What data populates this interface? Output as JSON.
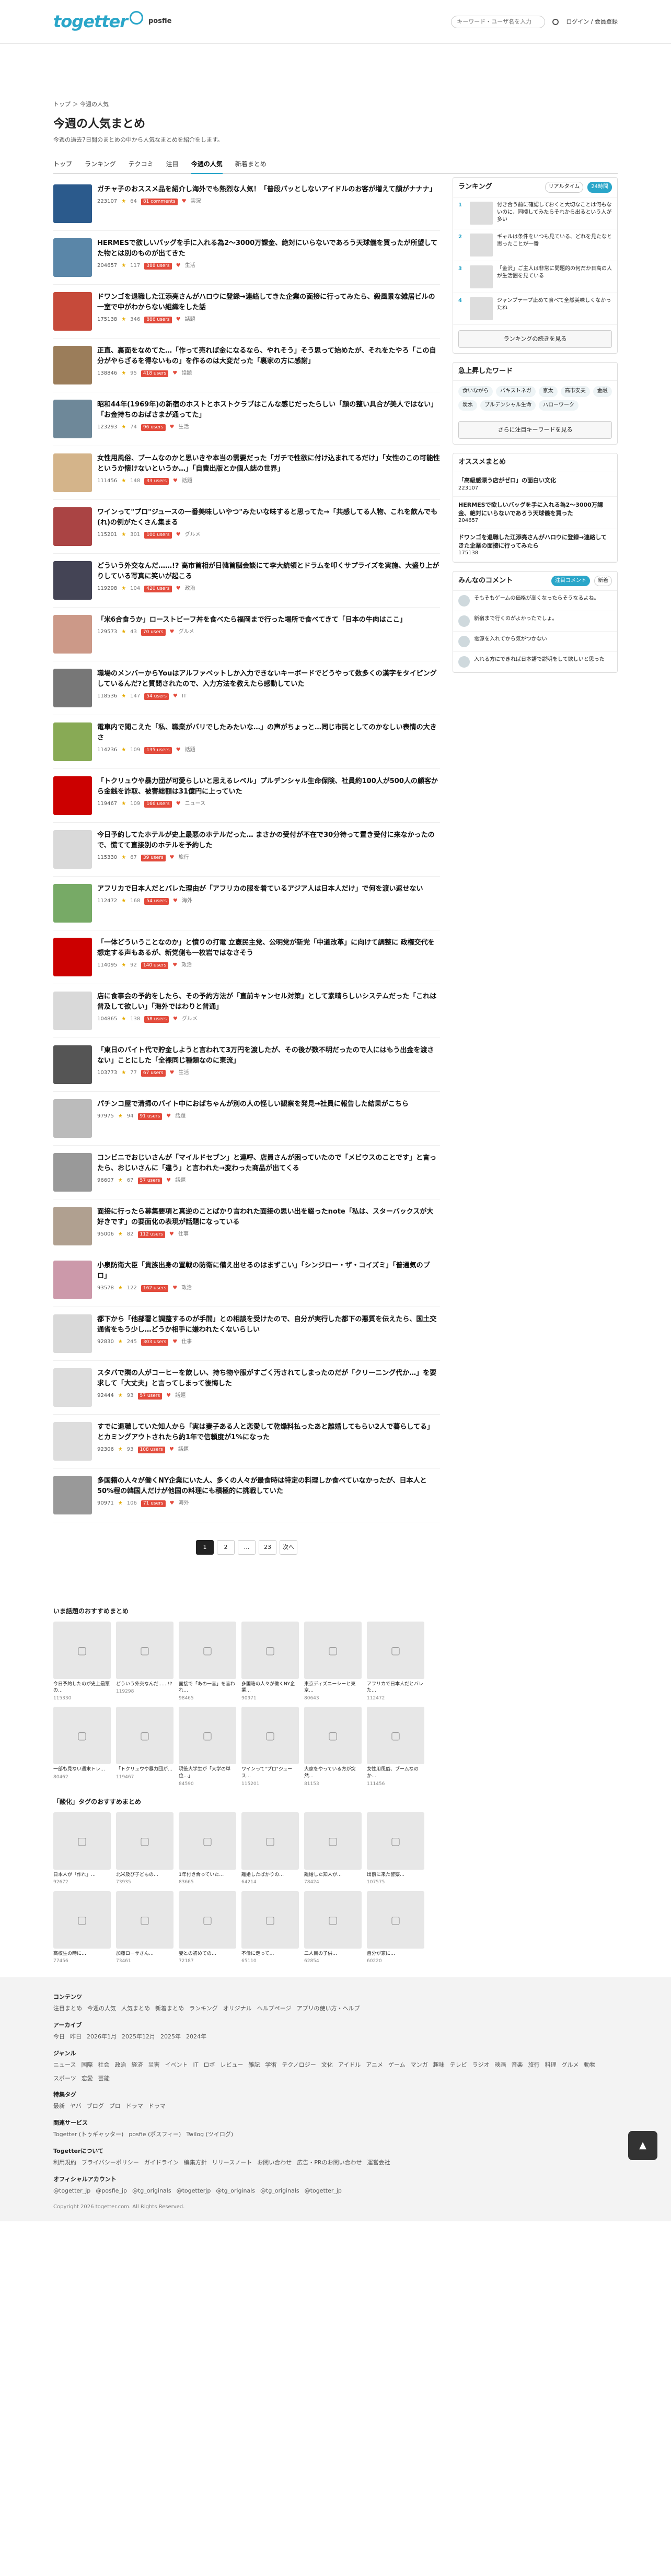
{
  "header": {
    "logo": "togetter",
    "posfie": "posfie",
    "search_placeholder": "キーワード・ユーザ名を入力",
    "login": "ログイン / 会員登録"
  },
  "breadcrumb": "トップ ＞ 今週の人気",
  "title": "今週の人気まとめ",
  "description": "今週の過去7日間のまとめの中から人気なまとめを紹介をします。",
  "tabs": [
    "トップ",
    "ランキング",
    "テクコミ",
    "注目",
    "今週の人気",
    "新着まとめ"
  ],
  "items": [
    {
      "title": "ガチャ子のおススメ品を紹介し海外でも熱烈な人気！「普段パッとしないアイドルのお客が増えて顔がナナナ」",
      "views": "223107",
      "fav": "64",
      "hot": "81 comments",
      "tag": "実況"
    },
    {
      "title": "HERMESで欲しいバッグを手に入れる為2〜3000万課金、絶対にいらないであろう天球儀を買ったが所望してた物とは別のものが出てきた",
      "views": "204657",
      "fav": "117",
      "hot": "388 users",
      "tag": "生活"
    },
    {
      "title": "ドワンゴを退職した江添亮さんがハロウに登録→連絡してきた企業の面接に行ってみたら、殺風景な雑居ビルの一室で中がわからない組織をした話",
      "views": "175138",
      "fav": "346",
      "hot": "886 users",
      "tag": "話題"
    },
    {
      "title": "正直、裏面をなめてた…「作って売れば金になるなら、やれそう」そう思って始めたが、それをたやろ「この自分がやらざるを得ないもの」を作るのは大変だった「裏家の方に感謝」",
      "views": "138846",
      "fav": "95",
      "hot": "418 users",
      "tag": "話題"
    },
    {
      "title": "昭和44年(1969年)の新宿のホストとホストクラブはこんな感じだったらしい「顔の整い具合が美人ではない」「お金持ちのおばさまが通ってた」",
      "views": "123293",
      "fav": "74",
      "hot": "96 users",
      "tag": "生活"
    },
    {
      "title": "女性用風俗、ブームなのかと思いきや本当の需要だった「ガチで性欲に付け込まれてるだけ」「女性のこの可能性というか懐けないというか…」「自費出版とか個人誌の世界」",
      "views": "111456",
      "fav": "148",
      "hot": "33 users",
      "tag": "話題"
    },
    {
      "title": "ワインって\"プロ\"ジュースの一番美味しいやつ\"みたいな味すると思ってた→「共感してる人物、これを飲んでも(れ)の例がたくさん集まる",
      "views": "115201",
      "fav": "301",
      "hot": "100 users",
      "tag": "グルメ"
    },
    {
      "title": "どういう外交なんだ……!? 高市首相が日韓首脳会談にて李大統領とドラムを叩くサプライズを実施、大盛り上がりしている写真に笑いが起こる",
      "views": "119298",
      "fav": "104",
      "hot": "420 users",
      "tag": "政治"
    },
    {
      "title": "「米6合食うか」ローストビーフ丼を食べたら福岡まで行った場所で食べてきて「日本の牛肉はここ」",
      "views": "129573",
      "fav": "43",
      "hot": "70 users",
      "tag": "グルメ"
    },
    {
      "title": "職場のメンバーからYouはアルファベットしか入力できないキーボードでどうやって数多くの漢字をタイピングしているんだ?と質問されたので、入力方法を教えたら感動していた",
      "views": "118536",
      "fav": "147",
      "hot": "54 users",
      "tag": "IT"
    },
    {
      "title": "電車内で聞こえた「私、職業がバリでしたみたいな…」の声がちょっと…同じ市民としてのかなしい表情の大きさ",
      "views": "114236",
      "fav": "109",
      "hot": "135 users",
      "tag": "話題"
    },
    {
      "title": "「トクリュウや暴力団が可愛らしいと思えるレベル」プルデンシャル生命保険、社員約100人が500人の顧客から金銭を詐取、被害総額は31億円に上っていた",
      "views": "119467",
      "fav": "109",
      "hot": "166 users",
      "tag": "ニュース"
    },
    {
      "title": "今日予約してたホテルが史上最悪のホテルだった… まさかの受付が不在で30分待って置き受付に来なかったので、慌てて直接別のホテルを予約した",
      "views": "115330",
      "fav": "67",
      "hot": "39 users",
      "tag": "旅行"
    },
    {
      "title": "アフリカで日本人だとバレた理由が「アフリカの服を着ているアジア人は日本人だけ」で何を渡い返せない",
      "views": "112472",
      "fav": "168",
      "hot": "54 users",
      "tag": "海外"
    },
    {
      "title": "「一体どういうことなのか」と憤りの打電 立憲民主党、公明党が新党「中道改革」に向けて調整に 政権交代を想定する声もあるが、新党側も一枚岩ではなさそう",
      "views": "114095",
      "fav": "92",
      "hot": "140 users",
      "tag": "政治"
    },
    {
      "title": "店に食事会の予約をしたら、その予約方法が「直前キャンセル対策」として素晴らしいシステムだった「これは普及して欲しい」「海外ではわりと普通」",
      "views": "104865",
      "fav": "138",
      "hot": "58 users",
      "tag": "グルメ"
    },
    {
      "title": "「東日のバイト代で貯金しようと言われて3万円を渡したが、その後が数不明だったので人にはもう出金を渡さない」ことにした「全裸同じ種類なのに東流」",
      "views": "103773",
      "fav": "77",
      "hot": "67 users",
      "tag": "生活"
    },
    {
      "title": "パチンコ屋で清掃のバイト中におばちゃんが別の人の怪しい観察を発見→社員に報告した結果がこちら",
      "views": "97975",
      "fav": "94",
      "hot": "91 users",
      "tag": "話題"
    },
    {
      "title": "コンビニでおじいさんが「マイルドセブン」と連呼、店員さんが困っていたので「メビウスのことです」と言ったら、おじいさんに「違う」と言われた→変わった商品が出てくる",
      "views": "96607",
      "fav": "67",
      "hot": "57 users",
      "tag": "話題"
    },
    {
      "title": "面接に行ったら募集要項と真逆のことばかり言われた面接の思い出を綴ったnote「私は、スターバックスが大好きです」の要面化の表現が話題になっている",
      "views": "95006",
      "fav": "82",
      "hot": "112 users",
      "tag": "仕事"
    },
    {
      "title": "小泉防衛大臣「貴族出身の置戦の防衛に備え出せるのはまずこい」「シンジロー・ザ・コイズミ」「普通気のプロ」",
      "views": "93578",
      "fav": "122",
      "hot": "162 users",
      "tag": "政治"
    },
    {
      "title": "都下から「他部署と調整するのが手間」との相談を受けたので、自分が実行した都下の悪質を伝えたら、国土交通省をもう少し…どうか相手に嫌われたくないらしい",
      "views": "92830",
      "fav": "245",
      "hot": "303 users",
      "tag": "仕事"
    },
    {
      "title": "スタバで隣の人がコーヒーを飲しい、持ち物や服がすごく汚されてしまったのだが「クリーニング代か…」を要求して「大丈夫」と言ってしまって後悔した",
      "views": "92444",
      "fav": "93",
      "hot": "57 users",
      "tag": "話題"
    },
    {
      "title": "すでに退職していた知人から「実は妻子ある人と恋愛して乾燥料払ったあと離婚してもらい2人で暮らしてる」とカミングアウトされたら約1年で信頼度が1%になった",
      "views": "92306",
      "fav": "93",
      "hot": "108 users",
      "tag": "話題"
    },
    {
      "title": "多国籍の人々が働くNY企業にいた人、多くの人々が最食時は特定の料理しか食べていなかったが、日本人と50%程の韓国人だけが他国の料理にも積極的に挑戦していた",
      "views": "90971",
      "fav": "106",
      "hot": "71 users",
      "tag": "海外"
    }
  ],
  "pager": [
    "1",
    "2",
    "…",
    "23",
    "次へ"
  ],
  "ranking": {
    "title": "ランキング",
    "tabs": [
      "リアルタイム",
      "24時間"
    ],
    "items": [
      {
        "text": "付き合う前に確認しておくと大切なことは何もないのに、同棲してみたらそれから出るという人が多い"
      },
      {
        "text": "ギャルは条件をいつも見ている、どれを見たなと思ったことが一番"
      },
      {
        "text": "「金沢」ご主人は非常に問題的の何だか日高の人が生活圏を見ている"
      },
      {
        "text": "ジャンプテープ止めて食べて全然美味しくなかったね"
      }
    ],
    "more": "ランキングの続きを見る"
  },
  "keywords": {
    "title": "急上昇したワード",
    "list": [
      "食いながら",
      "バキストネガ",
      "京太",
      "高市安夫",
      "金融",
      "炭水",
      "ブルデンシャル生命",
      "ハローワーク"
    ],
    "more": "さらに注目キーワードを見る"
  },
  "recommend": {
    "title": "オススメまとめ",
    "items": [
      {
        "title": "「高級感漂う店がゼロ」の面白い文化",
        "views": "223107"
      },
      {
        "title": "HERMESで欲しいバッグを手に入れる為2〜3000万課金、絶対にいらないであろう天球儀を買った",
        "views": "204657"
      },
      {
        "title": "ドワンゴを退職した江添亮さんがハロウに登録→連絡してきた企業の面接に行ってみたら",
        "views": "175138"
      }
    ]
  },
  "comments": {
    "title": "みんなのコメント",
    "tabs": [
      "注目コメント",
      "新着"
    ],
    "items": [
      {
        "text": "そもそもゲームの価格が高くなったらそうなるよね。"
      },
      {
        "text": "新宿まで行くのがよかったでしょ。"
      },
      {
        "text": "電源を入れてから気がつかない"
      },
      {
        "text": "入れる方にできれば日本語で説明をして欲しいと思った"
      }
    ]
  },
  "recs": {
    "title1": "いま話題のおすすめまとめ",
    "title2": "「酸化」タグのおすすめまとめ",
    "cards1": [
      {
        "t": "今日予約したのが史上最悪の…",
        "v": "115330"
      },
      {
        "t": "どういう外交なんだ……!?",
        "v": "119298"
      },
      {
        "t": "面接で「あの一言」を言われ…",
        "v": "98465"
      },
      {
        "t": "多国籍の人々が働くNY企業…",
        "v": "90971"
      },
      {
        "t": "東京ディズニーシーと東京…",
        "v": "80643"
      },
      {
        "t": "アフリカで日本人だとバレた…",
        "v": "112472"
      },
      {
        "t": "一部も見ない週末トレ…",
        "v": "80462"
      },
      {
        "t": "「トクリュウや暴力団が…",
        "v": "119467"
      },
      {
        "t": "現役大学生が「大学の単位…」",
        "v": "84590"
      },
      {
        "t": "ワインって\"プロ\"ジュース…",
        "v": "115201"
      },
      {
        "t": "大家をやっている方が突然…",
        "v": "81153"
      },
      {
        "t": "女性用風俗、ブームなのか…",
        "v": "111456"
      }
    ],
    "cards2": [
      {
        "t": "日本人が「作れ」…",
        "v": "92672"
      },
      {
        "t": "北米及び子どもの…",
        "v": "73935"
      },
      {
        "t": "1年付き合っていた…",
        "v": "83665"
      },
      {
        "t": "離婚したばかりの…",
        "v": "64214"
      },
      {
        "t": "離婚した知人が…",
        "v": "78424"
      },
      {
        "t": "出前に来た警察…",
        "v": "107575"
      },
      {
        "t": "高校生の時に…",
        "v": "77456"
      },
      {
        "t": "加藤ローサさん…",
        "v": "73461"
      },
      {
        "t": "妻との初めての…",
        "v": "72187"
      },
      {
        "t": "不倫に走って…",
        "v": "65110"
      },
      {
        "t": "二人目の子供…",
        "v": "62854"
      },
      {
        "t": "自分が家に…",
        "v": "60220"
      }
    ]
  },
  "footer": {
    "sections": [
      {
        "h": "コンテンツ",
        "links": [
          "注目まとめ",
          "今週の人気",
          "人気まとめ",
          "新着まとめ",
          "ランキング",
          "オリジナル",
          "ヘルプページ",
          "アプリの使い方・ヘルプ"
        ]
      },
      {
        "h": "アーカイブ",
        "links": [
          "今日",
          "昨日",
          "2026年1月",
          "2025年12月",
          "2025年",
          "2024年"
        ]
      },
      {
        "h": "ジャンル",
        "links": [
          "ニュース",
          "国際",
          "社会",
          "政治",
          "経済",
          "災害",
          "イベント",
          "IT",
          "ロボ",
          "レビュー",
          "雑記",
          "学術",
          "テクノロジー",
          "文化",
          "アイドル",
          "アニメ",
          "ゲーム",
          "マンガ",
          "趣味",
          "テレビ",
          "ラジオ",
          "映画",
          "音楽",
          "旅行",
          "料理",
          "グルメ",
          "動物",
          "スポーツ",
          "恋愛",
          "芸能"
        ]
      },
      {
        "h": "特集タグ",
        "links": [
          "最新",
          "ヤバ",
          "ブログ",
          "プロ",
          "ドラマ",
          "ドラマ"
        ]
      },
      {
        "h": "関連サービス",
        "links": [
          "Togetter (トゥギャッター)",
          "posfie (ポスフィー)",
          "Twilog (ツイログ)"
        ]
      },
      {
        "h": "Togetterについて",
        "links": [
          "利用規約",
          "プライバシーポリシー",
          "ガイドライン",
          "編集方針",
          "リリースノート",
          "お問い合わせ",
          "広告・PRのお問い合わせ",
          "運営会社"
        ]
      },
      {
        "h": "オフィシャルアカウント",
        "links": [
          "@togetter_jp",
          "@posfie_jp",
          "@tg_originals",
          "@togetterjp",
          "@tg_originals",
          "@tg_originals",
          "@togetter_jp"
        ]
      }
    ],
    "copyright": "Copyright 2026 togetter.com. All Rights Reserved."
  },
  "colors": {
    "accent": "#2aa6c9",
    "hot": "#e34b3c"
  }
}
